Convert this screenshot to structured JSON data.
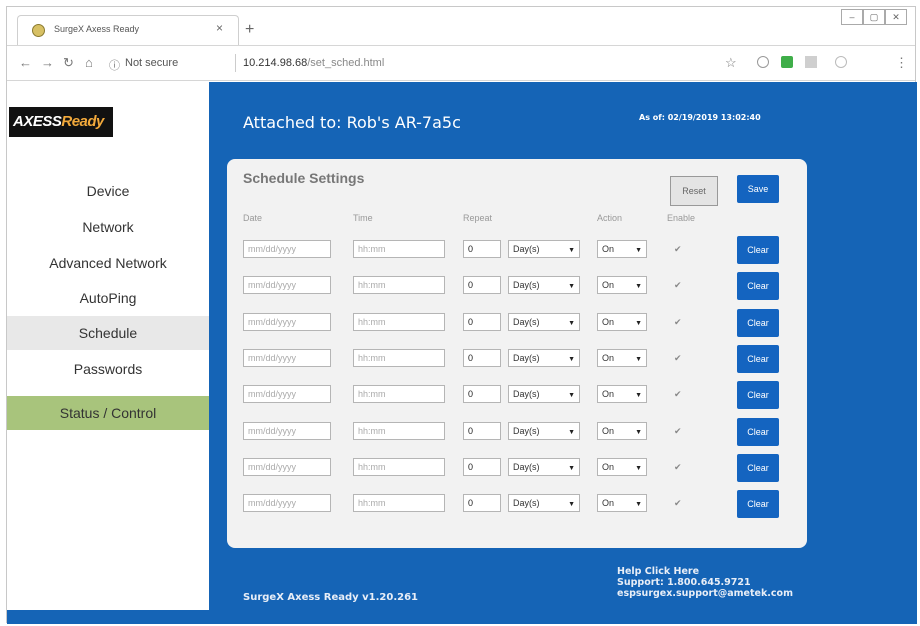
{
  "browser": {
    "tab_title": "SurgeX Axess Ready",
    "tab_close": "×",
    "new_tab": "+",
    "security_label": "Not secure",
    "url_host": "10.214.98.68",
    "url_path": "/set_sched.html"
  },
  "sidebar": {
    "logo_main": "AXESS",
    "logo_accent": "Ready",
    "items": [
      {
        "label": "Device"
      },
      {
        "label": "Network"
      },
      {
        "label": "Advanced Network"
      },
      {
        "label": "AutoPing"
      },
      {
        "label": "Schedule"
      },
      {
        "label": "Passwords"
      },
      {
        "label": "Status / Control"
      }
    ],
    "active_item": "Schedule"
  },
  "header": {
    "attached": "Attached to: Rob's AR-7a5c",
    "as_of": "As of: 02/19/2019 13:02:40"
  },
  "schedule": {
    "title": "Schedule Settings",
    "reset_label": "Reset",
    "save_label": "Save",
    "columns": {
      "date": "Date",
      "time": "Time",
      "repeat": "Repeat",
      "action": "Action",
      "enable": "Enable"
    },
    "rows": [
      {
        "date": "mm/dd/yyyy",
        "time": "hh:mm",
        "repeat_count": "0",
        "repeat_unit": "Day(s)",
        "action": "On",
        "enabled": true,
        "clear_label": "Clear"
      },
      {
        "date": "mm/dd/yyyy",
        "time": "hh:mm",
        "repeat_count": "0",
        "repeat_unit": "Day(s)",
        "action": "On",
        "enabled": true,
        "clear_label": "Clear"
      },
      {
        "date": "mm/dd/yyyy",
        "time": "hh:mm",
        "repeat_count": "0",
        "repeat_unit": "Day(s)",
        "action": "On",
        "enabled": true,
        "clear_label": "Clear"
      },
      {
        "date": "mm/dd/yyyy",
        "time": "hh:mm",
        "repeat_count": "0",
        "repeat_unit": "Day(s)",
        "action": "On",
        "enabled": true,
        "clear_label": "Clear"
      },
      {
        "date": "mm/dd/yyyy",
        "time": "hh:mm",
        "repeat_count": "0",
        "repeat_unit": "Day(s)",
        "action": "On",
        "enabled": true,
        "clear_label": "Clear"
      },
      {
        "date": "mm/dd/yyyy",
        "time": "hh:mm",
        "repeat_count": "0",
        "repeat_unit": "Day(s)",
        "action": "On",
        "enabled": true,
        "clear_label": "Clear"
      },
      {
        "date": "mm/dd/yyyy",
        "time": "hh:mm",
        "repeat_count": "0",
        "repeat_unit": "Day(s)",
        "action": "On",
        "enabled": true,
        "clear_label": "Clear"
      },
      {
        "date": "mm/dd/yyyy",
        "time": "hh:mm",
        "repeat_count": "0",
        "repeat_unit": "Day(s)",
        "action": "On",
        "enabled": true,
        "clear_label": "Clear"
      }
    ]
  },
  "footer": {
    "version": "SurgeX Axess Ready v1.20.261",
    "help": "Help Click Here",
    "support": "Support: 1.800.645.9721",
    "email": "espsurgex.support@ametek.com"
  },
  "colors": {
    "page_blue": "#1564b6",
    "button_blue": "#1464c0",
    "status_green": "#a8c47c",
    "active_gray": "#e8e8e8"
  }
}
